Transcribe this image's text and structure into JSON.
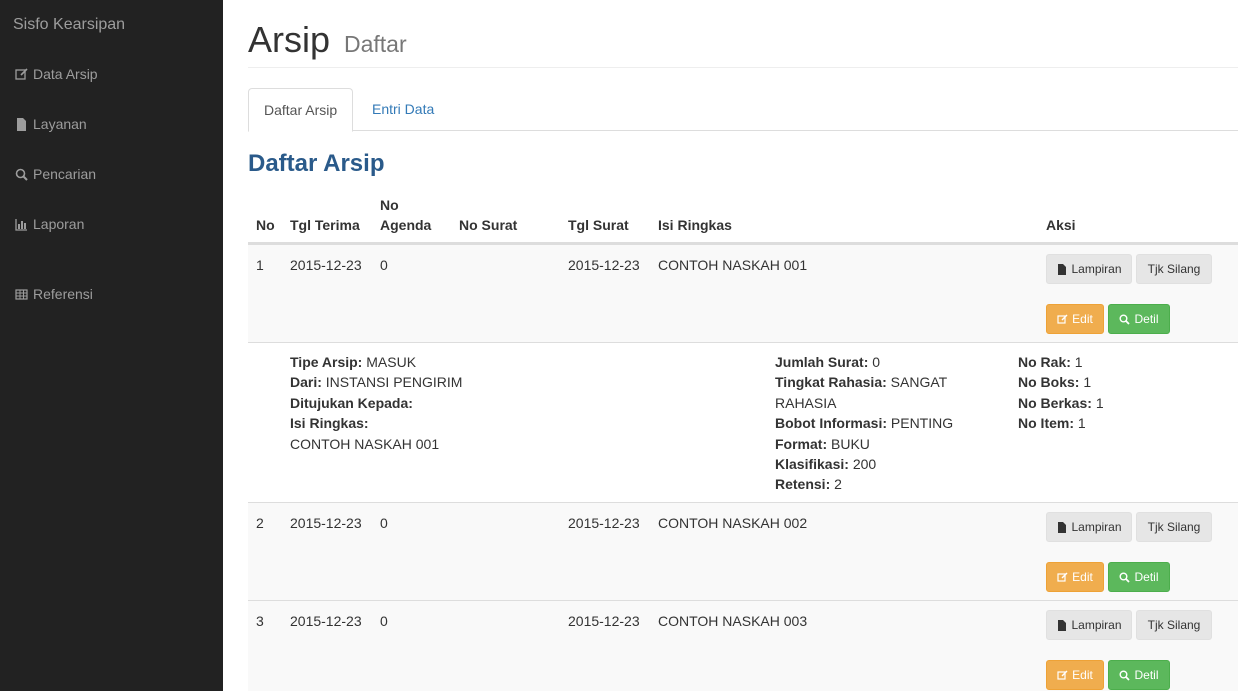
{
  "sidebar": {
    "brand": "Sisfo Kearsipan",
    "items": [
      {
        "label": "Data Arsip",
        "icon": "edit-icon"
      },
      {
        "label": "Layanan",
        "icon": "file-icon"
      },
      {
        "label": "Pencarian",
        "icon": "search-icon"
      },
      {
        "label": "Laporan",
        "icon": "chart-icon"
      },
      {
        "label": "Referensi",
        "icon": "table-icon"
      }
    ]
  },
  "header": {
    "title": "Arsip",
    "subtitle": "Daftar"
  },
  "tabs": [
    {
      "label": "Daftar Arsip"
    },
    {
      "label": "Entri Data"
    }
  ],
  "section_title": "Daftar Arsip",
  "table": {
    "columns": [
      "No",
      "Tgl Terima",
      "No Agenda",
      "No Surat",
      "Tgl Surat",
      "Isi Ringkas",
      "Aksi"
    ],
    "col_no_agenda_l1": "No",
    "col_no_agenda_l2": "Agenda",
    "rows": [
      {
        "no": "1",
        "tgl_terima": "2015-12-23",
        "no_agenda": "0",
        "no_surat": "",
        "tgl_surat": "2015-12-23",
        "isi_ringkas": "CONTOH NASKAH 001"
      },
      {
        "no": "2",
        "tgl_terima": "2015-12-23",
        "no_agenda": "0",
        "no_surat": "",
        "tgl_surat": "2015-12-23",
        "isi_ringkas": "CONTOH NASKAH 002"
      },
      {
        "no": "3",
        "tgl_terima": "2015-12-23",
        "no_agenda": "0",
        "no_surat": "",
        "tgl_surat": "2015-12-23",
        "isi_ringkas": "CONTOH NASKAH 003"
      }
    ],
    "actions": {
      "lampiran": "Lampiran",
      "tjk_silang": "Tjk Silang",
      "edit": "Edit",
      "detil": "Detil"
    }
  },
  "detail": {
    "tipe_arsip_label": "Tipe Arsip:",
    "tipe_arsip": "MASUK",
    "dari_label": "Dari:",
    "dari": "INSTANSI PENGIRIM",
    "ditujukan_label": "Ditujukan Kepada:",
    "isi_ringkas_label": "Isi Ringkas:",
    "isi_ringkas": "CONTOH NASKAH 001",
    "jumlah_surat_label": "Jumlah Surat:",
    "jumlah_surat": "0",
    "tingkat_rahasia_label": "Tingkat Rahasia:",
    "tingkat_rahasia_1": "SANGAT",
    "tingkat_rahasia_2": "RAHASIA",
    "bobot_label": "Bobot Informasi:",
    "bobot": "PENTING",
    "format_label": "Format:",
    "format": "BUKU",
    "klasifikasi_label": "Klasifikasi:",
    "klasifikasi": "200",
    "retensi_label": "Retensi:",
    "retensi": "2",
    "no_rak_label": "No Rak:",
    "no_rak": "1",
    "no_boks_label": "No Boks:",
    "no_boks": "1",
    "no_berkas_label": "No Berkas:",
    "no_berkas": "1",
    "no_item_label": "No Item:",
    "no_item": "1"
  }
}
